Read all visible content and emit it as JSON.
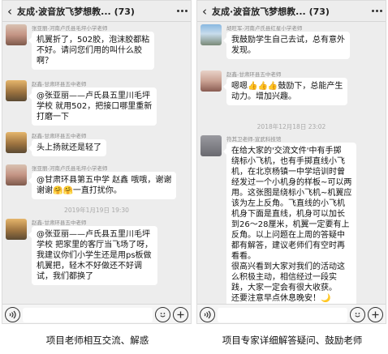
{
  "left": {
    "title": "友成·波音放飞梦想教...",
    "count": "(73)",
    "messages": [
      {
        "sender": "张亚丽-河南卢氏县毛坪小学老师",
        "lines": [
          "机翼折了，502胶，泡沫胶都粘",
          "不好。请问您们用的叫什么胶",
          "啊？"
        ]
      },
      {
        "sender": "赵鑫-甘肃环县五中老师",
        "lines": [
          "@张亚丽——卢氏县五里川毛坪",
          "学校 就用502，把接口哪里重新",
          "打磨一下"
        ]
      },
      {
        "sender": "赵鑫-甘肃环县五中老师",
        "lines": [
          "头上扬就还是轻了"
        ]
      },
      {
        "sender": "张亚丽-河南卢氏县毛坪小学老师",
        "lines": [
          "@甘肃环县第五中学 赵鑫 哦哦，谢谢",
          "谢谢🤗🤗一直打扰你。"
        ]
      },
      {
        "sender": "赵鑫-甘肃环县五中老师",
        "lines": [
          "@张亚丽——卢氏县五里川毛坪",
          "学校 把家里的客厅当飞场了呀，",
          "我建议你们小学生还是用ps板做",
          "机翼把，轻木不好做还不好调",
          "试，我们都换了"
        ]
      }
    ],
    "timestamp": "2019年1月19日 19:30",
    "caption": "项目老师相互交流、解惑"
  },
  "right": {
    "title": "友成·波音放飞梦想教...",
    "count": "(73)",
    "messages": [
      {
        "sender": "胡旺军-河南卢氏县红星小学老师",
        "lines": [
          "我鼓励学生自己去试，总有意外",
          "发现。"
        ]
      },
      {
        "sender": "赵鑫-甘肃环县五中老师",
        "lines": [
          "嗯嗯👍👍👍鼓励下，总能产生",
          "动力。增加兴趣。"
        ]
      },
      {
        "sender": "符其卫老师-宣武科技馆",
        "lines": [
          "在给大家的'交流文件'中有手掷",
          "绕标小飞机，也有手掷直线小飞",
          "机，在北京杨镇一中学培训时曾",
          "经发过一个小机身的样板~可以两",
          "用。这张图是绕标小飞机~机翼应",
          "该为左上反角。飞直线的小飞机",
          "机身下面是直线，机身可以加长",
          "到26～28厘米，机翼一定要有上",
          "反角。以上问题在上周的答疑中",
          "都有解答，建议老师们有空时再",
          "看看。",
          "很高兴看到大家对我们的活动这",
          "么积极主动，相信经过一段实",
          "践，大家一定会有很大收获。",
          "还要注意早点休息晚安！🌙"
        ]
      }
    ],
    "timestamp": "2018年12月18日 23:02",
    "caption": "项目专家详细解答疑问、鼓励老师"
  }
}
